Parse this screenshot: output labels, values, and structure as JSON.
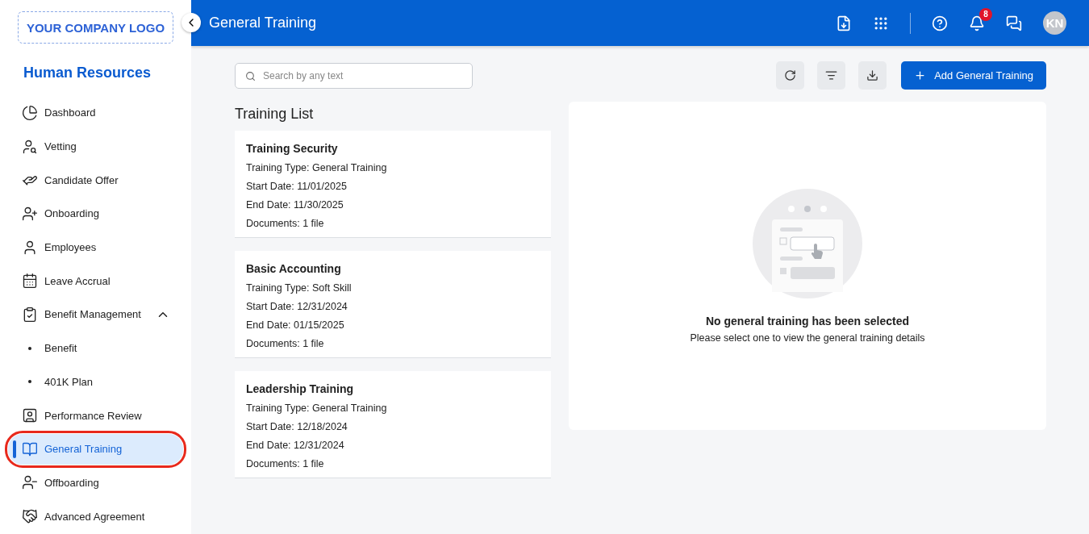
{
  "sidebar": {
    "logo": "YOUR COMPANY LOGO",
    "section_title": "Human Resources",
    "items": [
      {
        "kind": "icon",
        "label": "Dashboard",
        "selected": false
      },
      {
        "kind": "icon",
        "label": "Vetting",
        "selected": false
      },
      {
        "kind": "icon",
        "label": "Candidate Offer",
        "selected": false
      },
      {
        "kind": "icon",
        "label": "Onboarding",
        "selected": false
      },
      {
        "kind": "icon",
        "label": "Employees",
        "selected": false
      },
      {
        "kind": "icon",
        "label": "Leave Accrual",
        "selected": false
      },
      {
        "kind": "group",
        "label": "Benefit Management",
        "selected": false,
        "expanded": true
      },
      {
        "kind": "sub",
        "label": "Benefit",
        "selected": false
      },
      {
        "kind": "sub",
        "label": "401K Plan",
        "selected": false
      },
      {
        "kind": "icon",
        "label": "Performance Review",
        "selected": false
      },
      {
        "kind": "icon",
        "label": "General Training",
        "selected": true,
        "highlighted": true
      },
      {
        "kind": "icon",
        "label": "Offboarding",
        "selected": false
      },
      {
        "kind": "icon",
        "label": "Advanced Agreement",
        "selected": false
      }
    ]
  },
  "header": {
    "title": "General Training",
    "notifications": "8",
    "avatar": "KN"
  },
  "toolbar": {
    "search": {
      "placeholder": "Search by any text"
    },
    "add_button": "Add General Training"
  },
  "list": {
    "title": "Training List",
    "cards": [
      {
        "title": "Training Security",
        "lines": [
          "Training Type: General Training",
          "Start Date: 11/01/2025",
          "End Date: 11/30/2025",
          "Documents: 1 file"
        ]
      },
      {
        "title": "Basic Accounting",
        "lines": [
          "Training Type: Soft Skill",
          "Start Date: 12/31/2024",
          "End Date: 01/15/2025",
          "Documents: 1 file"
        ]
      },
      {
        "title": "Leadership Training",
        "lines": [
          "Training Type: General Training",
          "Start Date: 12/18/2024",
          "End Date: 12/31/2024",
          "Documents: 1 file"
        ]
      }
    ]
  },
  "detail": {
    "empty_title": "No general training has been selected",
    "empty_text": "Please select one to view the general training details"
  }
}
